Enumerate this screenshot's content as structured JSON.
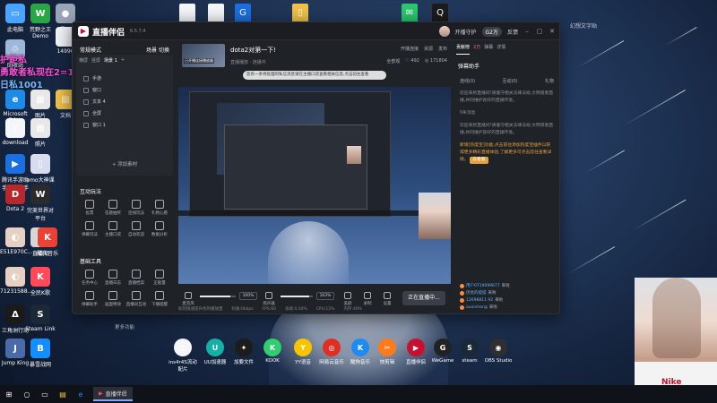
{
  "window": {
    "title": "直播伴侣",
    "version": "6.5.7.4"
  },
  "titlebar": {
    "open_guard": "开播守护",
    "level_pill": "G2万",
    "feedback": "反馈"
  },
  "desktop": {
    "overlay_line1": "护距私",
    "overlay_line2": "勇敢者私现在2=1",
    "overlay_line3": "日私1001",
    "right_label": "幻想文字贴",
    "icons_left": [
      {
        "label": "此电脑",
        "color": "#4aa3ff",
        "glyph": "▭"
      },
      {
        "label": "荒野之王 Demo",
        "color": "#27a844",
        "glyph": "W"
      },
      {
        "label": "星际",
        "color": "#9aa5b8",
        "glyph": "●"
      },
      {
        "label": "14996",
        "color": "#f4f6fa",
        "glyph": "▯"
      },
      {
        "label": "回收站",
        "color": "#9fb7d8",
        "glyph": "♲"
      },
      {
        "label": "Microsoft Edge",
        "color": "#1e8ae8",
        "glyph": "e"
      },
      {
        "label": "图片",
        "color": "#e8e8e8",
        "glyph": "▦"
      },
      {
        "label": "文档",
        "color": "#f0c24a",
        "glyph": "▤"
      },
      {
        "label": "download",
        "color": "#f4f6fa",
        "glyph": "▯"
      },
      {
        "label": "照片",
        "color": "#e8e8e8",
        "glyph": "▦"
      },
      {
        "label": "腾讯手游助手 - 精抖手机",
        "color": "#1b6fe0",
        "glyph": "▶"
      },
      {
        "label": "emo大神课 程包",
        "color": "#d7ddee",
        "glyph": "▯"
      },
      {
        "label": "Dota 2",
        "color": "#b7282e",
        "glyph": "D"
      },
      {
        "label": "完美世界对平台",
        "color": "#2b2b2b",
        "glyph": "W"
      },
      {
        "label": "E51E970C...",
        "color": "#e6d0c4",
        "glyph": "◐"
      },
      {
        "label": "直播间",
        "color": "#d6d6d6",
        "glyph": "◑"
      },
      {
        "label": "酷我音乐",
        "color": "#ea4335",
        "glyph": "K"
      },
      {
        "label": "71231588...",
        "color": "#e6d0c4",
        "glyph": "◐"
      },
      {
        "label": "全民K歌",
        "color": "#ff4a5a",
        "glyph": "K"
      },
      {
        "label": "三角洲行动",
        "color": "#1a1a1a",
        "glyph": "Δ"
      },
      {
        "label": "Steam Link",
        "color": "#1b2838",
        "glyph": "S"
      },
      {
        "label": "Jump King",
        "color": "#4a6aa8",
        "glyph": "J"
      },
      {
        "label": "暴雪战网",
        "color": "#148eff",
        "glyph": "B"
      }
    ],
    "top_icons": [
      {
        "color": "#f4f6fa",
        "glyph": ""
      },
      {
        "color": "#f4f6fa",
        "glyph": ""
      },
      {
        "color": "#1b6fe0",
        "glyph": "G"
      },
      {
        "color": "#f0c24a",
        "glyph": "▯"
      },
      {
        "color": "#2ac86e",
        "glyph": "✉"
      },
      {
        "color": "#1c1c1c",
        "glyph": "Q"
      }
    ],
    "dock": [
      {
        "label": "ins4r4S流动 配片",
        "color": "#f4f6fa",
        "glyph": "▯"
      },
      {
        "label": "UU加速器",
        "color": "#16b0a8",
        "glyph": "U"
      },
      {
        "label": "加要文件",
        "color": "#1c1c1c",
        "glyph": "✦"
      },
      {
        "label": "KOOK",
        "color": "#2fce6e",
        "glyph": "K"
      },
      {
        "label": "YY语音",
        "color": "#f6c500",
        "glyph": "Y"
      },
      {
        "label": "网易云音乐",
        "color": "#e02e24",
        "glyph": "◎"
      },
      {
        "label": "酷狗音乐",
        "color": "#1d8bf2",
        "glyph": "K"
      },
      {
        "label": "快剪辑",
        "color": "#ff7a1a",
        "glyph": "✂"
      },
      {
        "label": "直播伴侣",
        "color": "#c8102e",
        "glyph": "▶"
      },
      {
        "label": "WeGame",
        "color": "#222",
        "glyph": "G"
      },
      {
        "label": "steam",
        "color": "#1b2838",
        "glyph": "S"
      },
      {
        "label": "OBS Studio",
        "color": "#302e31",
        "glyph": "◉"
      }
    ]
  },
  "left_panel": {
    "mode_label": "常规模式",
    "mode_actions": [
      "场景",
      "切换"
    ],
    "scene_tabs": [
      "横屏",
      "竖屏",
      "场景 1",
      "+"
    ],
    "sources": [
      "手游",
      "窗口",
      "文本 4",
      "全屏",
      "窗口 1"
    ],
    "add_source": "+ 添加素材",
    "interact_title": "互动玩法",
    "interact_tools": [
      "投票",
      "答题抽奖",
      "连线玩法",
      "礼物心愿",
      "弹幕玩法",
      "主播口袋",
      "自动欢迎",
      "数据分析"
    ],
    "basic_title": "基础工具",
    "basic_tools": [
      "任务中心",
      "直播日志",
      "直播档案",
      "正能量",
      "弹幕助手",
      "画面特效",
      "直播间互动",
      "下播提醒"
    ],
    "more": "更多功能"
  },
  "stream": {
    "thumb_label": "已开播连接播放器",
    "title": "dota2对第一下!",
    "subtitle": "直播播放 · 连播中",
    "stats_top": [
      "开播连接",
      "资源",
      "发布"
    ],
    "stats": [
      "全部观",
      "♡ 492",
      "◎ 171804"
    ],
    "notice": "您有一条待处理的私信消息请在主播口袋查看相关信息,点击前往查看",
    "mic_label": "麦克风",
    "speaker_label": "扬声器",
    "mic_vol": "100%",
    "speaker_vol": "103%",
    "mic_level": 0.86,
    "speaker_level": 0.9,
    "ctrl_icons": [
      "美颜",
      "录制",
      "设置"
    ],
    "live_button": "正在直播中..."
  },
  "statusbar": {
    "items": [
      "如何快速提升你的播放量",
      "码速:0kbps",
      "FPS:60",
      "丢帧:0.00%",
      "CPU:12%",
      "内存:49%"
    ]
  },
  "right_panel": {
    "tabs": [
      "贡献榜",
      "2万",
      "弹幕",
      "详情"
    ],
    "danmu_head": "弹幕助手",
    "danmu_tabs": [
      "连线(0)",
      "互动(0)",
      "礼物"
    ],
    "messages": [
      {
        "text": "欢迎来到直播间!请遵守相关法律法规,文明观看直播,共同维护良好的直播环境。",
        "hl": false
      },
      {
        "text": "0条消息",
        "hl": false
      },
      {
        "text": "欢迎来到直播间!请遵守相关法律法规,文明观看直播,共同维护良好的直播环境。",
        "hl": false
      },
      {
        "text": "新增[热度宝]功能,点击前往添加热度宝插件以获得更多精彩直播体验,了解更多可点击前往查看详情。",
        "hl": true
      }
    ],
    "go_btn": "去看看",
    "gifts": [
      {
        "name": "用户0719099677",
        "action": "来啦"
      },
      {
        "name": "优优的提提",
        "action": "来啦"
      },
      {
        "name": "12698811 92",
        "action": "来啦"
      },
      {
        "name": "auxinhang",
        "action": "来啦"
      }
    ]
  },
  "taskbar": {
    "task_label": "直播伴侣"
  },
  "webcam": {
    "shirt_text": "Nike"
  }
}
